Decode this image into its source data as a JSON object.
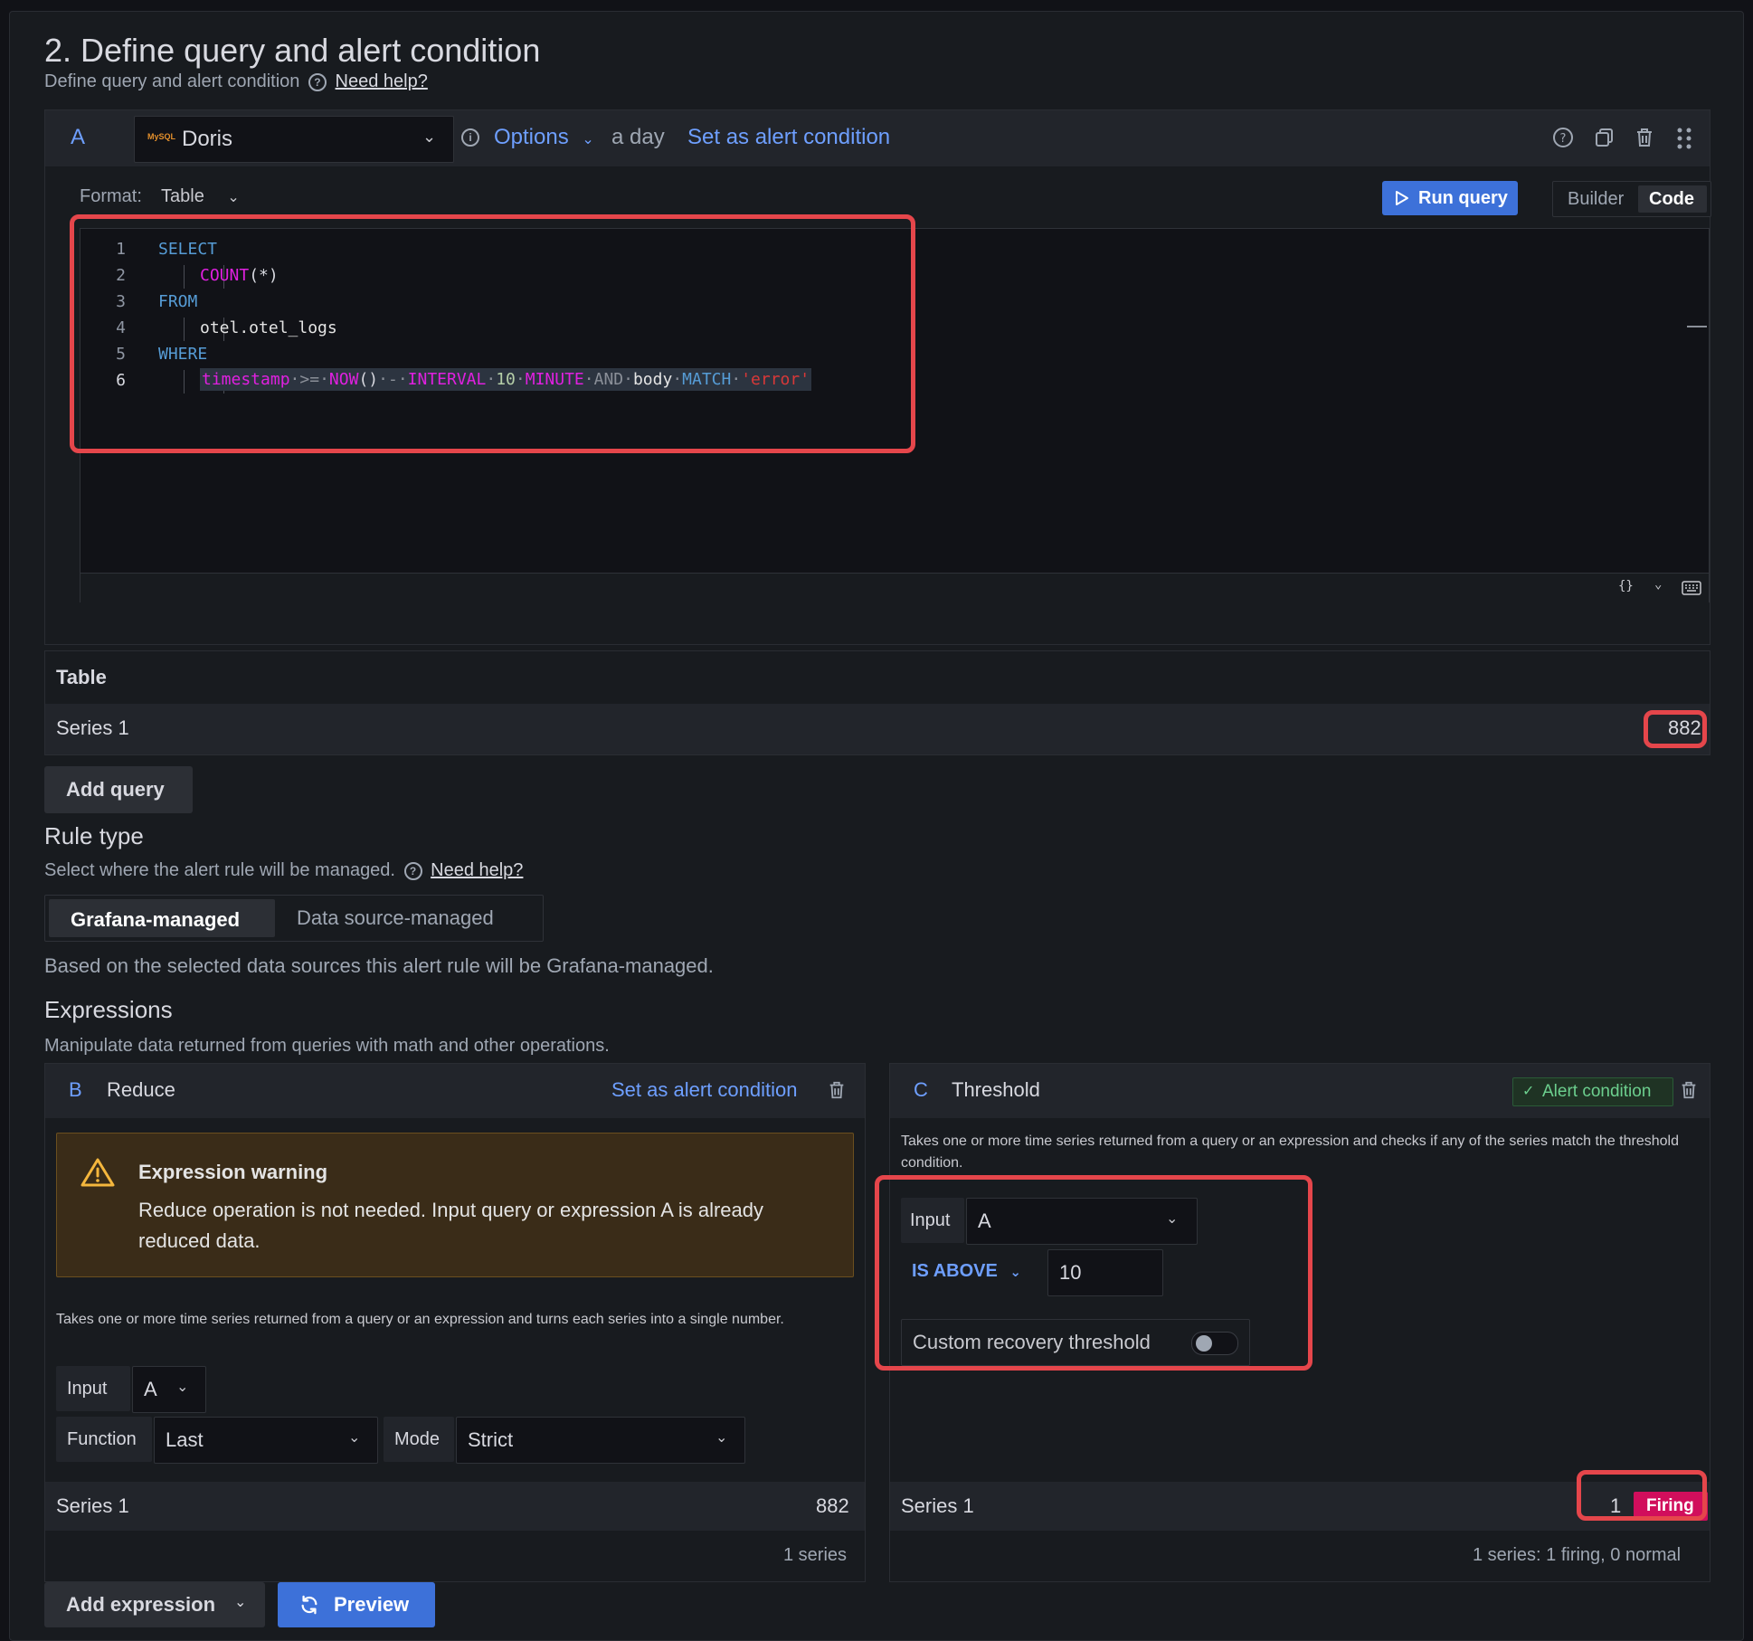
{
  "section": {
    "title": "2. Define query and alert condition",
    "subtitle": "Define query and alert condition",
    "help_link": "Need help?"
  },
  "query": {
    "ref": "A",
    "datasource": "Doris",
    "datasource_logo_text": "MySQL",
    "options_label": "Options",
    "time_range": "a day",
    "set_alert_label": "Set as alert condition",
    "format_label": "Format:",
    "format_value": "Table",
    "run_query_label": "Run query",
    "mode_builder": "Builder",
    "mode_code": "Code",
    "code_lines": [
      "1",
      "2",
      "3",
      "4",
      "5",
      "6"
    ],
    "code": {
      "l1": "SELECT",
      "l2_fn": "COUNT",
      "l2_args": "(*)",
      "l3": "FROM",
      "l4": "otel.otel_logs",
      "l5": "WHERE",
      "l6_col": "timestamp",
      "l6_op": ">=",
      "l6_fn": "NOW",
      "l6_paren": "()",
      "l6_minus": "-",
      "l6_interval": "INTERVAL",
      "l6_num": "10",
      "l6_unit": "MINUTE",
      "l6_and": "AND",
      "l6_body": "body",
      "l6_match": "MATCH",
      "l6_str": "'error'"
    },
    "editor_footer_braces": "{}"
  },
  "result": {
    "header": "Table",
    "series_name": "Series 1",
    "series_value": "882"
  },
  "add_query_label": "Add query",
  "rule_type": {
    "title": "Rule type",
    "subtitle": "Select where the alert rule will be managed.",
    "help_link": "Need help?",
    "option_grafana": "Grafana-managed",
    "option_ds": "Data source-managed",
    "note": "Based on the selected data sources this alert rule will be Grafana-managed."
  },
  "expressions": {
    "title": "Expressions",
    "subtitle": "Manipulate data returned from queries with math and other operations.",
    "reduce": {
      "ref": "B",
      "name": "Reduce",
      "set_alert_label": "Set as alert condition",
      "warning_title": "Expression warning",
      "warning_text": "Reduce operation is not needed. Input query or expression A is already reduced data.",
      "description": "Takes one or more time series returned from a query or an expression and turns each series into a single number.",
      "input_label": "Input",
      "input_value": "A",
      "function_label": "Function",
      "function_value": "Last",
      "mode_label": "Mode",
      "mode_value": "Strict",
      "series_name": "Series 1",
      "series_value": "882",
      "footer": "1 series"
    },
    "threshold": {
      "ref": "C",
      "name": "Threshold",
      "alert_badge": "Alert condition",
      "description": "Takes one or more time series returned from a query or an expression and checks if any of the series match the threshold condition.",
      "input_label": "Input",
      "input_value": "A",
      "operator": "IS ABOVE",
      "threshold_value": "10",
      "recovery_label": "Custom recovery threshold",
      "series_name": "Series 1",
      "series_value": "1",
      "state": "Firing",
      "footer": "1 series: 1 firing, 0 normal"
    }
  },
  "add_expression_label": "Add expression",
  "preview_label": "Preview",
  "colors": {
    "accent_blue": "#6e9fff",
    "primary_button": "#3d71d9",
    "highlight_red": "#e5464b",
    "firing": "#d10e5c",
    "success_green": "#6ccf8e",
    "warning_bg": "#3a2c18"
  }
}
